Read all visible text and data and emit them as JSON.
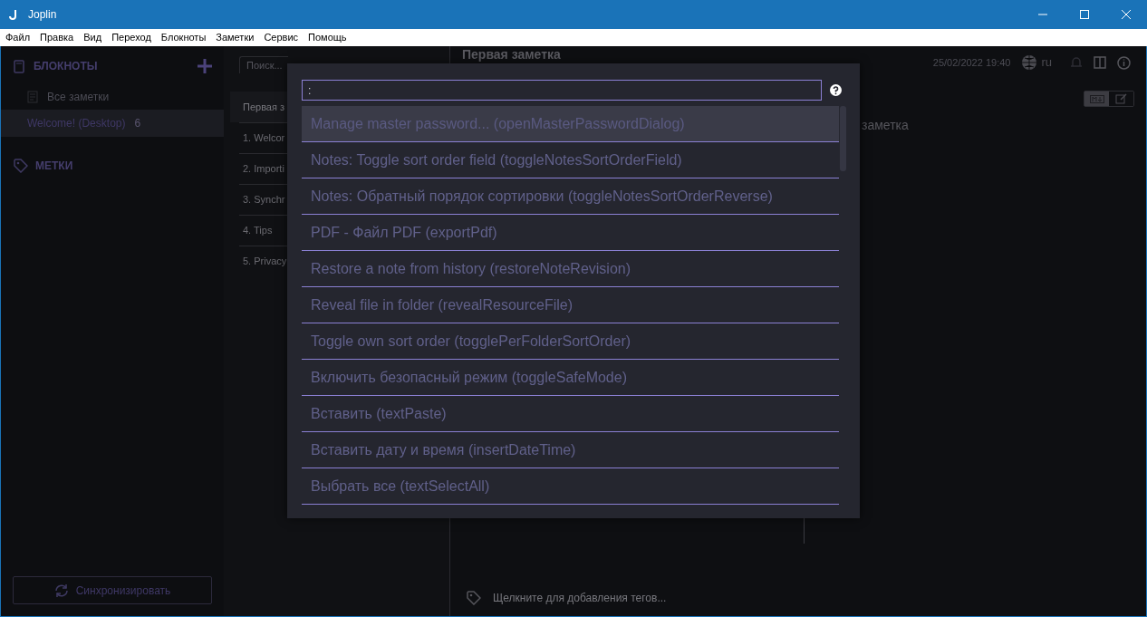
{
  "window": {
    "title": "Joplin"
  },
  "menu": [
    "Файл",
    "Правка",
    "Вид",
    "Переход",
    "Блокноты",
    "Заметки",
    "Сервис",
    "Помощь"
  ],
  "sidebar": {
    "notebooks_header": "БЛОКНОТЫ",
    "all_notes": "Все заметки",
    "notebooks": [
      {
        "name": "Welcome! (Desktop)",
        "count": "6",
        "selected": true
      }
    ],
    "tags_header": "МЕТКИ",
    "sync_button": "Синхронизировать"
  },
  "note_list": {
    "search_placeholder": "Поиск...",
    "notes": [
      {
        "title": "Первая з",
        "selected": true
      },
      {
        "title": "1. Welcor",
        "selected": false
      },
      {
        "title": "2. Importi",
        "selected": false
      },
      {
        "title": "3. Synchr",
        "selected": false
      },
      {
        "title": "4. Tips",
        "selected": false
      },
      {
        "title": "5. Privacy",
        "selected": false
      }
    ]
  },
  "editor": {
    "view_toggles": [
      {
        "kind": "markdown",
        "selected": true
      },
      {
        "kind": "editor",
        "selected": false
      }
    ],
    "title": "Первая заметка",
    "date": "25/02/2022 19:40",
    "language": "ru",
    "body": "заметка",
    "tags_placeholder": "Щелкните для добавления тегов..."
  },
  "command_palette": {
    "query": ":",
    "items": [
      {
        "label": "Manage master password... (openMasterPasswordDialog)",
        "selected": true
      },
      {
        "label": "Notes: Toggle sort order field (toggleNotesSortOrderField)",
        "selected": false
      },
      {
        "label": "Notes: Обратный порядок сортировки (toggleNotesSortOrderReverse)",
        "selected": false
      },
      {
        "label": "PDF - Файл PDF (exportPdf)",
        "selected": false
      },
      {
        "label": "Restore a note from history (restoreNoteRevision)",
        "selected": false
      },
      {
        "label": "Reveal file in folder (revealResourceFile)",
        "selected": false
      },
      {
        "label": "Toggle own sort order (togglePerFolderSortOrder)",
        "selected": false
      },
      {
        "label": "Включить безопасный режим (toggleSafeMode)",
        "selected": false
      },
      {
        "label": "Вставить (textPaste)",
        "selected": false
      },
      {
        "label": "Вставить дату и время (insertDateTime)",
        "selected": false
      },
      {
        "label": "Выбрать все (textSelectAll)",
        "selected": false
      }
    ]
  }
}
